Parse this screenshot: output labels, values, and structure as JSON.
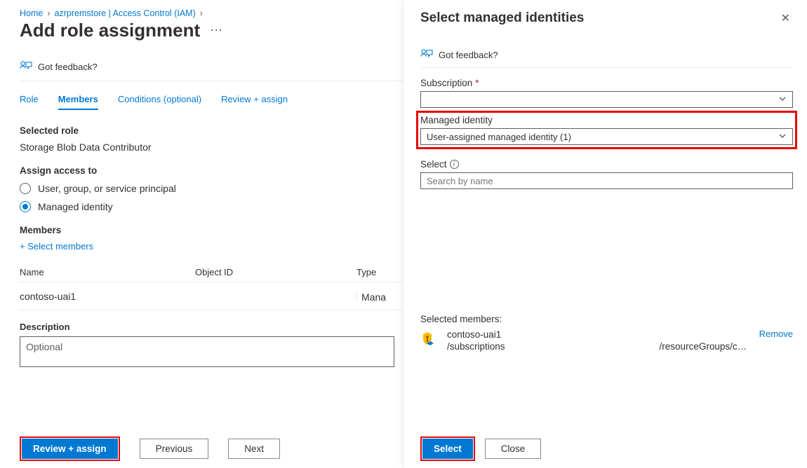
{
  "breadcrumb": {
    "home": "Home",
    "resource": "azrpremstore | Access Control (IAM)"
  },
  "page_title": "Add role assignment",
  "feedback_label": "Got feedback?",
  "tabs": {
    "role": "Role",
    "members": "Members",
    "conditions": "Conditions (optional)",
    "review": "Review + assign"
  },
  "selected_role": {
    "heading": "Selected role",
    "value": "Storage Blob Data Contributor"
  },
  "assign_access": {
    "heading": "Assign access to",
    "option_principal": "User, group, or service principal",
    "option_mi": "Managed identity"
  },
  "members": {
    "heading": "Members",
    "select_link": "Select members",
    "col_name": "Name",
    "col_id": "Object ID",
    "col_type": "Type",
    "row": {
      "name": "contoso-uai1",
      "type": "Mana"
    }
  },
  "description": {
    "heading": "Description",
    "placeholder": "Optional"
  },
  "left_buttons": {
    "review": "Review + assign",
    "previous": "Previous",
    "next": "Next"
  },
  "blade": {
    "title": "Select managed identities",
    "feedback": "Got feedback?",
    "subscription_label": "Subscription",
    "mi_label": "Managed identity",
    "mi_value": "User-assigned managed identity (1)",
    "select_label": "Select",
    "search_placeholder": "Search by name",
    "selected_heading": "Selected members:",
    "selected": {
      "name": "contoso-uai1",
      "path1": "/subscriptions",
      "path2": "/resourceGroups/c…"
    },
    "remove": "Remove",
    "btn_select": "Select",
    "btn_close": "Close"
  }
}
